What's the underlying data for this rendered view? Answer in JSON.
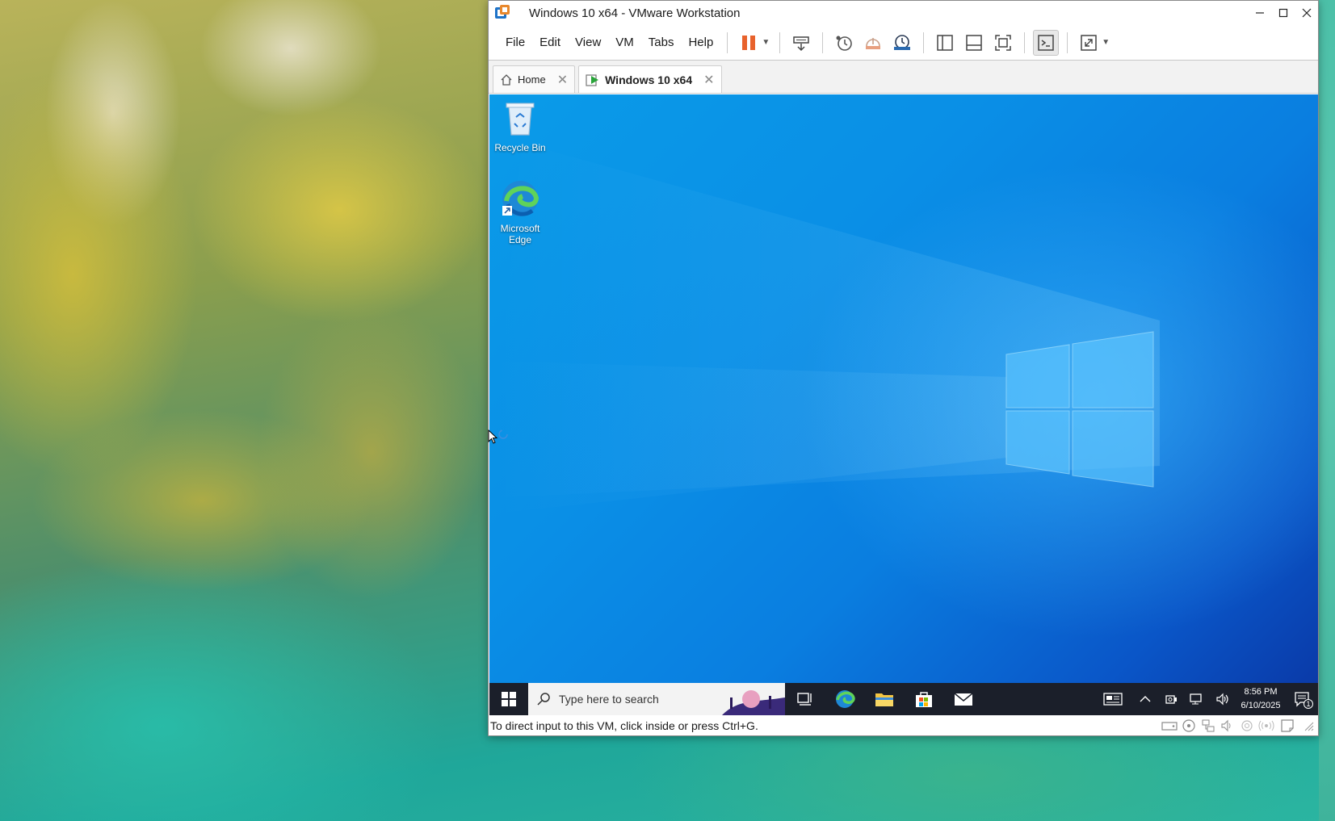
{
  "window": {
    "title": "Windows 10 x64 - VMware Workstation",
    "controls": [
      "minimize",
      "maximize",
      "close"
    ]
  },
  "menu": {
    "items": [
      "File",
      "Edit",
      "View",
      "VM",
      "Tabs",
      "Help"
    ]
  },
  "toolbar": {
    "icons": [
      "pause-icon",
      "send-ctrl-alt-del-icon",
      "snapshot-icon",
      "revert-snapshot-icon",
      "snapshot-manager-icon",
      "library-icon",
      "thumbnail-bar-icon",
      "full-screen-icon",
      "console-view-icon",
      "stretch-guest-icon"
    ]
  },
  "tabs": [
    {
      "label": "Home",
      "active": false
    },
    {
      "label": "Windows 10 x64",
      "active": true
    }
  ],
  "guest": {
    "desktop_icons": [
      {
        "label": "Recycle Bin",
        "icon": "recycle-bin-icon"
      },
      {
        "label": "Microsoft Edge",
        "icon": "edge-icon"
      }
    ],
    "taskbar": {
      "search_placeholder": "Type here to search",
      "pinned": [
        "task-view-icon",
        "edge-icon",
        "file-explorer-icon",
        "store-icon",
        "mail-icon"
      ],
      "clock_time": "8:56 PM",
      "clock_date": "6/10/2025",
      "notification_count": "1"
    }
  },
  "status": {
    "message": "To direct input to this VM, click inside or press Ctrl+G."
  },
  "colors": {
    "accent_blue": "#0a7ee0",
    "vmware_orange": "#e8882c",
    "pause_orange": "#e8622c",
    "taskbar": "#1b1f2a"
  }
}
